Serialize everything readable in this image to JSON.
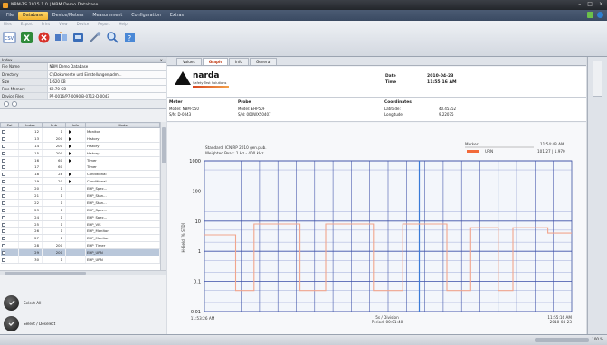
{
  "window": {
    "title": "NBM-TS 2015 1.0 | NBM Demo Database"
  },
  "menu": {
    "items": [
      "File",
      "Database",
      "Device/Meters",
      "Measurement",
      "Configuration",
      "Extras"
    ],
    "active": "Database"
  },
  "ribbon": {
    "groups": [
      "Files",
      "Export",
      "Print",
      "View",
      "Device",
      "Report",
      "Help"
    ]
  },
  "properties": {
    "title": "Index",
    "rows": [
      {
        "k": "File Name",
        "v": "NBM Demo Database"
      },
      {
        "k": "Directory",
        "v": "C:\\Dokumente und Einstellungen\\adm..."
      },
      {
        "k": "Size",
        "v": "1.620 KB"
      },
      {
        "k": "Free Memory",
        "v": "62.70 GB"
      },
      {
        "k": "Device Files",
        "v": "P7-0016/P7-0090-B-0712-D-0043"
      }
    ]
  },
  "grid": {
    "headers": [
      "Sel",
      "Index",
      "Sub",
      "Info",
      "Mode"
    ],
    "rows": [
      {
        "index": "12",
        "sub": "1",
        "info": true,
        "mode": "Monitor"
      },
      {
        "index": "13",
        "sub": "200",
        "info": true,
        "mode": "History"
      },
      {
        "index": "14",
        "sub": "200",
        "info": true,
        "mode": "History"
      },
      {
        "index": "15",
        "sub": "200",
        "info": true,
        "mode": "History"
      },
      {
        "index": "16",
        "sub": "60",
        "info": true,
        "mode": "Timer"
      },
      {
        "index": "17",
        "sub": "60",
        "info": false,
        "mode": "Timer"
      },
      {
        "index": "18",
        "sub": "28",
        "info": true,
        "mode": "Conditional"
      },
      {
        "index": "19",
        "sub": "20",
        "info": true,
        "mode": "Conditional"
      },
      {
        "index": "20",
        "sub": "1",
        "info": false,
        "mode": "EHP_Spec..."
      },
      {
        "index": "21",
        "sub": "1",
        "info": false,
        "mode": "EHP_Stan..."
      },
      {
        "index": "22",
        "sub": "1",
        "info": false,
        "mode": "EHP_Stan..."
      },
      {
        "index": "23",
        "sub": "1",
        "info": false,
        "mode": "EHP_Spec..."
      },
      {
        "index": "24",
        "sub": "1",
        "info": false,
        "mode": "EHP_Spec..."
      },
      {
        "index": "25",
        "sub": "1",
        "info": false,
        "mode": "EHP_VIS"
      },
      {
        "index": "26",
        "sub": "1",
        "info": false,
        "mode": "EHP_Monitor"
      },
      {
        "index": "27",
        "sub": "1",
        "info": false,
        "mode": "EHP_Monitor"
      },
      {
        "index": "28",
        "sub": "200",
        "info": false,
        "mode": "EHP_Timer"
      },
      {
        "index": "29",
        "sub": "200",
        "info": false,
        "mode": "EHP_URN",
        "selected": true
      },
      {
        "index": "30",
        "sub": "1",
        "info": false,
        "mode": "EHP_URN"
      }
    ]
  },
  "buttons": {
    "select_all": "Select All",
    "select_deselect": "Select / Deselect"
  },
  "doc_tabs": [
    "Values",
    "Graph",
    "Info",
    "General"
  ],
  "active_tab": "Graph",
  "header": {
    "logo": "narda",
    "logo_sub": "Safety Test Solutions",
    "date_label": "Date",
    "date_value": "2010-04-23",
    "time_label": "Time",
    "time_value": "11:55:16 AM"
  },
  "info": {
    "meter_h": "Meter",
    "meter_model": "Model:  NBM-550",
    "meter_sn": "S/N:    D-0043",
    "probe_h": "Probe",
    "probe_model": "Model:  EHP50F",
    "probe_sn": "S/N:    000WX50407",
    "coord_h": "Coordinates",
    "lat_label": "Latitude:",
    "lat_value": "40.45352",
    "lon_label": "Longitude:",
    "lon_value": "9.22075"
  },
  "chart_data": {
    "type": "line",
    "standard_text": "Standard: ICNIRP 2010 gen.pub.",
    "weighting_text": "Weighted Peak: 1 Hz - 400 kHz",
    "ylabel": "H-Field [% STD]",
    "y_scale": "log",
    "ylim": [
      0.01,
      1000
    ],
    "y_ticks": [
      "1000",
      "100",
      "10",
      "1",
      "0.1",
      "0.01"
    ],
    "legend_header": [
      "Marker:",
      "11:54:43 AM"
    ],
    "legend_entry": {
      "name": "URN",
      "value": "101.27 | 1.970",
      "color": "#f26a3a"
    },
    "x_start_time": "11:53:26 AM",
    "x_center_top": "5s / Division",
    "x_center_bottom": "Period: 00:01:40",
    "x_end_time": "11:55:16 AM",
    "x_end_date": "2010-04-23",
    "grid": true,
    "series": [
      {
        "name": "URN",
        "color": "#f1a58d",
        "points": [
          [
            0,
            3.5
          ],
          [
            8.5,
            3.5
          ],
          [
            8.5,
            0.05
          ],
          [
            13.5,
            0.05
          ],
          [
            13.5,
            8
          ],
          [
            26,
            8
          ],
          [
            26,
            0.05
          ],
          [
            33,
            0.05
          ],
          [
            33,
            8
          ],
          [
            46,
            8
          ],
          [
            46,
            0.05
          ],
          [
            54,
            0.05
          ],
          [
            54,
            8
          ],
          [
            66,
            8
          ],
          [
            66,
            0.05
          ],
          [
            72.5,
            0.05
          ],
          [
            72.5,
            6
          ],
          [
            80,
            6
          ],
          [
            80,
            0.05
          ],
          [
            84,
            0.05
          ],
          [
            84,
            6
          ],
          [
            93.5,
            6
          ],
          [
            93.5,
            4
          ],
          [
            100,
            4
          ]
        ]
      }
    ],
    "marker_fraction": 0.585
  },
  "status": {
    "zoom": "100 %"
  }
}
